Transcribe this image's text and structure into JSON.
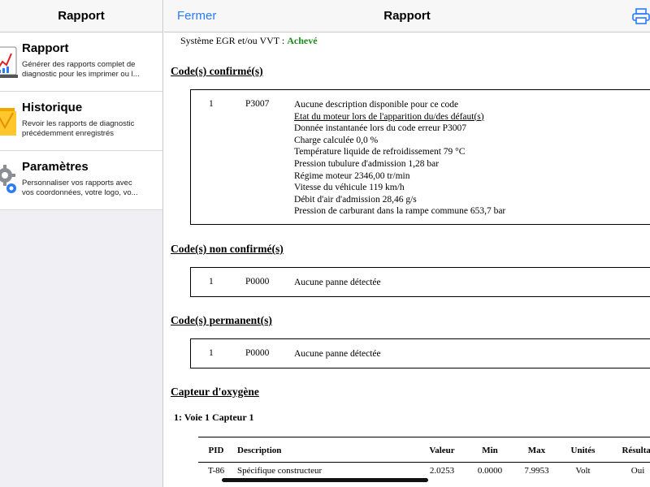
{
  "sidebar": {
    "title": "Rapport",
    "items": [
      {
        "icon": "report-chart-icon",
        "title": "Rapport",
        "desc1": "Générer des rapports complet de",
        "desc2": "diagnostic pour les imprimer ou l..."
      },
      {
        "icon": "folder-icon",
        "title": "Historique",
        "desc1": "Revoir les rapports de diagnostic",
        "desc2": "précédemment enregistrés"
      },
      {
        "icon": "gear-icon",
        "title": "Paramètres",
        "desc1": "Personnaliser vos rapports avec",
        "desc2": "vos coordonnées, votre logo, vo..."
      }
    ]
  },
  "topbar": {
    "close_label": "Fermer",
    "title": "Rapport",
    "print_icon": "printer-icon"
  },
  "report": {
    "egr_label": "Système EGR et/ou VVT :",
    "egr_status": "Achevé",
    "confirmed": {
      "title": "Code(s) confirmé(s)",
      "num": "1",
      "code": "P3007",
      "lines": [
        "Aucune description disponible pour ce code",
        "Etat du moteur lors de l'apparition du/des défaut(s)",
        "Donnée instantanée lors du code erreur P3007",
        "Charge calculée 0,0 %",
        "Température liquide de refroidissement 79 °C",
        "Pression tubulure d'admission 1,28 bar",
        "Régime moteur 2346,00 tr/min",
        "Vitesse du véhicule 119 km/h",
        "Débit d'air d'admission 28,46 g/s",
        "Pression de carburant dans la rampe commune 653,7 bar"
      ]
    },
    "unconfirmed": {
      "title": "Code(s) non confirmé(s)",
      "num": "1",
      "code": "P0000",
      "desc": "Aucune panne détectée"
    },
    "permanent": {
      "title": "Code(s) permanent(s)",
      "num": "1",
      "code": "P0000",
      "desc": "Aucune panne détectée"
    },
    "oxygen": {
      "title": "Capteur d'oxygène",
      "subtitle": "1: Voie 1 Capteur 1",
      "headers": [
        "PID",
        "Description",
        "Valeur",
        "Min",
        "Max",
        "Unités",
        "Résultat"
      ],
      "rows": [
        [
          "T-86",
          "Spécifique constructeur",
          "2.0253",
          "0.0000",
          "7.9953",
          "Volt",
          "Oui"
        ]
      ]
    }
  },
  "colors": {
    "accent": "#2a7bf6",
    "success": "#1d8a1d"
  }
}
